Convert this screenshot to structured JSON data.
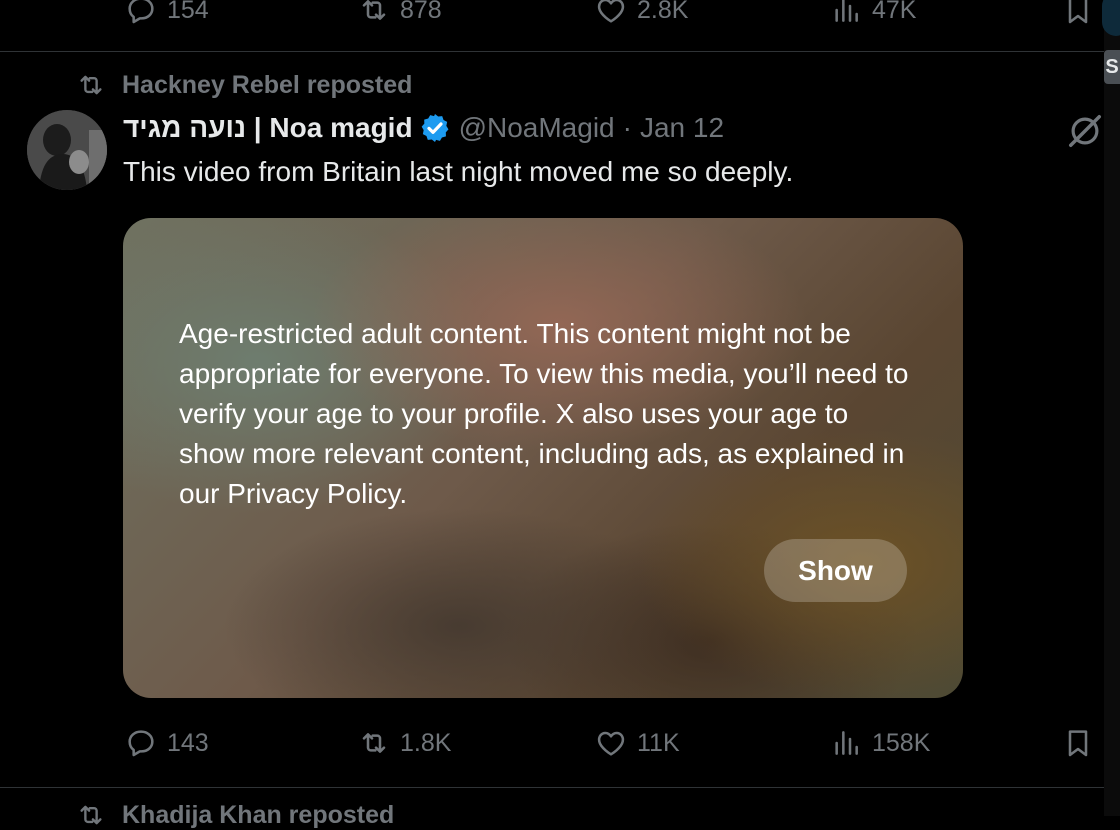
{
  "prev_tweet": {
    "replies": "154",
    "reposts": "878",
    "likes": "2.8K",
    "views": "47K"
  },
  "tooltip_text": "S",
  "tweet": {
    "repost_by": "Hackney Rebel reposted",
    "author_name": "נועה מגיד | Noa magid",
    "handle": "@NoaMagid",
    "separator": "·",
    "date": "Jan 12",
    "text": "This video from Britain last night moved me so deeply.",
    "media_warning": "Age-restricted adult content. This content might not be appropriate for everyone. To view this media, you’ll need to verify your age to your profile. X also uses your age to show more relevant content, including ads, as explained in our Privacy Policy.",
    "show_label": "Show",
    "replies": "143",
    "reposts": "1.8K",
    "likes": "11K",
    "views": "158K"
  },
  "next_tweet": {
    "repost_by": "Khadija Khan reposted"
  },
  "colors": {
    "background": "#000000",
    "text_primary": "#e7e9ea",
    "text_secondary": "#71767b",
    "verified": "#1d9bf0",
    "divider": "#2f3336"
  },
  "icons": {
    "reply": "reply-icon",
    "repost": "repost-icon",
    "like": "like-icon",
    "views": "views-icon",
    "bookmark": "bookmark-icon",
    "verified": "verified-badge-icon",
    "grok": "grok-icon"
  }
}
